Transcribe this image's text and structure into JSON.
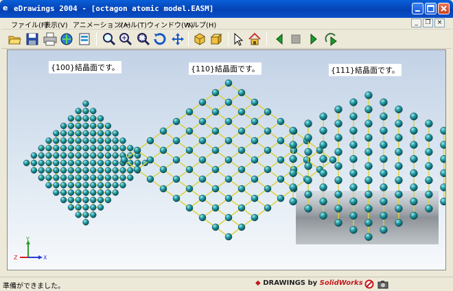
{
  "window": {
    "logo_text": "e",
    "title": "eDrawings 2004 - [octagon atomic model.EASM]"
  },
  "menu": [
    {
      "label": "ファイル(F)"
    },
    {
      "label": "表示(V)"
    },
    {
      "label": "アニメーション(A)"
    },
    {
      "label": "ツール(T)"
    },
    {
      "label": "ウィンドウ(W)"
    },
    {
      "label": "ヘルプ(H)"
    }
  ],
  "toolbar_icons": [
    "open-icon",
    "save-icon",
    "print-icon",
    "send-icon",
    "print-preview-icon",
    "zoom-to-fit-icon",
    "zoom-in-out-icon",
    "zoom-to-area-icon",
    "rotate-icon",
    "pan-icon",
    "isometric-view-icon",
    "shaded-view-icon",
    "select-icon",
    "home-icon",
    "previous-icon",
    "stop-icon",
    "play-icon",
    "continuous-play-icon"
  ],
  "labels": {
    "l100": "{100}結晶面です。",
    "l110": "{110}結晶面です。",
    "l111": "{111}結晶面です。"
  },
  "triad": {
    "y": "Y",
    "z": "Z",
    "x": "X"
  },
  "status": {
    "text": "準備ができました。",
    "brand_prefix": "DRAWINGS",
    "brand_by": "by",
    "brand_name": "SolidWorks"
  },
  "colors": {
    "atom": "#1f8f97",
    "atom_highlight": "#a8ecef",
    "bond": "#d8d23a",
    "title_bar": "#0a4fc8"
  }
}
